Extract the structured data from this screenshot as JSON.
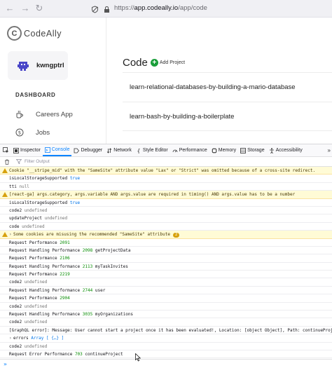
{
  "browser": {
    "url_prefix": "https://",
    "url_host": "app.codeally.io",
    "url_path": "/app/code"
  },
  "app": {
    "logo_text": "CodeAlly",
    "logo_mark": "C",
    "username": "kwngptrl",
    "dashboard_label": "DASHBOARD",
    "sidebar": [
      {
        "label": "Careers App",
        "icon": "coffee-icon"
      },
      {
        "label": "Jobs",
        "icon": "dollar-icon"
      }
    ],
    "code_title": "Code",
    "add_project_label": "Add Project",
    "projects": [
      "learn-relational-databases-by-building-a-mario-database",
      "learn-bash-by-building-a-boilerplate"
    ]
  },
  "devtools": {
    "tabs": [
      {
        "label": "Inspector",
        "icon": "inspector-icon",
        "active": false
      },
      {
        "label": "Console",
        "icon": "console-icon",
        "active": true
      },
      {
        "label": "Debugger",
        "icon": "debugger-icon",
        "active": false
      },
      {
        "label": "Network",
        "icon": "network-icon",
        "active": false
      },
      {
        "label": "Style Editor",
        "icon": "style-editor-icon",
        "active": false
      },
      {
        "label": "Performance",
        "icon": "performance-icon",
        "active": false
      },
      {
        "label": "Memory",
        "icon": "memory-icon",
        "active": false
      },
      {
        "label": "Storage",
        "icon": "storage-icon",
        "active": false
      },
      {
        "label": "Accessibility",
        "icon": "accessibility-icon",
        "active": false
      }
    ],
    "more_label": "»",
    "filter_placeholder": "Filter Output",
    "prompt": "»"
  },
  "console": [
    {
      "kind": "warn",
      "text": "Cookie \"__stripe_mid\" with the \"SameSite\" attribute value \"Lax\" or \"Strict\" was omitted because of a cross-site redirect."
    },
    {
      "kind": "log",
      "text": "isLocalStorageSupported",
      "value": "true",
      "vclass": "kw"
    },
    {
      "kind": "log",
      "text": "tti",
      "value": "null",
      "vclass": "grey"
    },
    {
      "kind": "warn",
      "text": "[react-ga] args.category, args.variable AND args.value are required in timing() AND args.value has to be a number"
    },
    {
      "kind": "log",
      "text": "isLocalStorageSupported",
      "value": "true",
      "vclass": "kw"
    },
    {
      "kind": "log",
      "text": "code2",
      "value": "undefined",
      "vclass": "grey"
    },
    {
      "kind": "log",
      "text": "updateProject",
      "value": "undefined",
      "vclass": "grey"
    },
    {
      "kind": "log",
      "text": "code",
      "value": "undefined",
      "vclass": "grey"
    },
    {
      "kind": "warn",
      "text": "Some cookies are misusing the recommended \"SameSite\" attribute",
      "caret": "›",
      "badge": "2"
    },
    {
      "kind": "log",
      "text": "Request Performance",
      "value": "2091",
      "vclass": "num"
    },
    {
      "kind": "log",
      "text": "Request Handling Performance",
      "value": "2098",
      "vclass": "num",
      "tail": "getProjectData"
    },
    {
      "kind": "log",
      "text": "Request Performance",
      "value": "2106",
      "vclass": "num"
    },
    {
      "kind": "log",
      "text": "Request Handling Performance",
      "value": "2113",
      "vclass": "num",
      "tail": "myTaskInvites"
    },
    {
      "kind": "log",
      "text": "Request Performance",
      "value": "2219",
      "vclass": "num"
    },
    {
      "kind": "log",
      "text": "code2",
      "value": "undefined",
      "vclass": "grey"
    },
    {
      "kind": "log",
      "text": "Request Handling Performance",
      "value": "2744",
      "vclass": "num",
      "tail": "user"
    },
    {
      "kind": "log",
      "text": "Request Performance",
      "value": "2904",
      "vclass": "num"
    },
    {
      "kind": "log",
      "text": "code2",
      "value": "undefined",
      "vclass": "grey"
    },
    {
      "kind": "log",
      "text": "Request Handling Performance",
      "value": "3035",
      "vclass": "num",
      "tail": "myOrganizations"
    },
    {
      "kind": "log",
      "text": "code2",
      "value": "undefined",
      "vclass": "grey"
    },
    {
      "kind": "log",
      "text": "[GraphQL error]: Message: User cannot start a project once it has been evaluated!, Location: [object Object], Path: continueProject"
    },
    {
      "kind": "log",
      "text": "errors",
      "caret": "›",
      "value": "Array [ {…} ]",
      "vclass": "kw"
    },
    {
      "kind": "log",
      "text": "code2",
      "value": "undefined",
      "vclass": "grey"
    },
    {
      "kind": "log",
      "text": "Request Error Performance",
      "value": "703",
      "vclass": "num",
      "tail": "continueProject"
    }
  ],
  "colors": {
    "accent": "#0a84ff",
    "warning_bg": "#fffbd6",
    "number_green": "#058b00",
    "add_button_green": "#1a9e3a"
  }
}
